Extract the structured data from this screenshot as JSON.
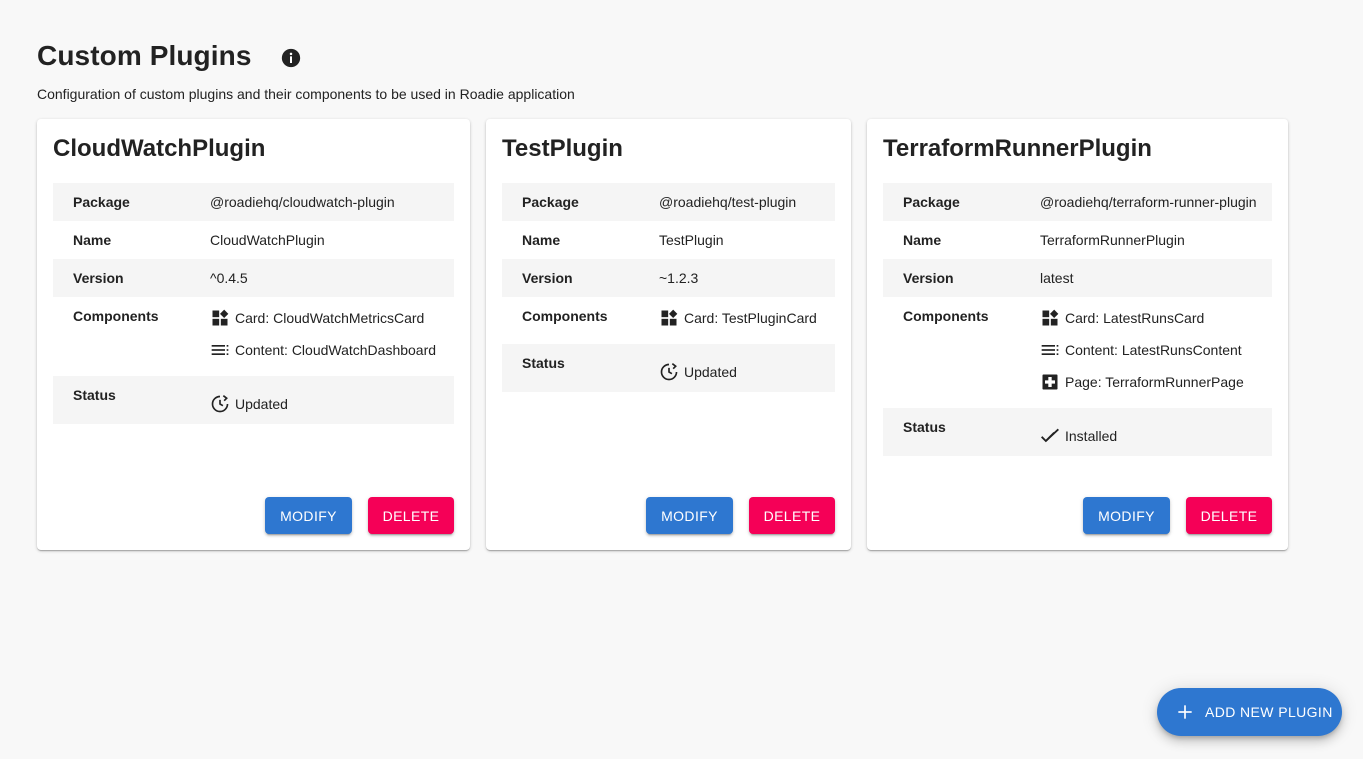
{
  "header": {
    "title": "Custom Plugins",
    "subtitle": "Configuration of custom plugins and their components to be used in Roadie application"
  },
  "labels": {
    "package": "Package",
    "name": "Name",
    "version": "Version",
    "components": "Components",
    "status": "Status",
    "modify": "MODIFY",
    "delete": "DELETE"
  },
  "plugins": [
    {
      "title": "CloudWatchPlugin",
      "package": "@roadiehq/cloudwatch-plugin",
      "name": "CloudWatchPlugin",
      "version": "^0.4.5",
      "components": [
        {
          "icon": "card-icon",
          "text": "Card: CloudWatchMetricsCard"
        },
        {
          "icon": "content-icon",
          "text": "Content: CloudWatchDashboard"
        }
      ],
      "status": {
        "icon": "updated-icon",
        "text": "Updated"
      }
    },
    {
      "title": "TestPlugin",
      "package": "@roadiehq/test-plugin",
      "name": "TestPlugin",
      "version": "~1.2.3",
      "components": [
        {
          "icon": "card-icon",
          "text": "Card: TestPluginCard"
        }
      ],
      "status": {
        "icon": "updated-icon",
        "text": "Updated"
      }
    },
    {
      "title": "TerraformRunnerPlugin",
      "package": "@roadiehq/terraform-runner-plugin",
      "name": "TerraformRunnerPlugin",
      "version": "latest",
      "components": [
        {
          "icon": "card-icon",
          "text": "Card: LatestRunsCard"
        },
        {
          "icon": "content-icon",
          "text": "Content: LatestRunsContent"
        },
        {
          "icon": "page-icon",
          "text": "Page: TerraformRunnerPage"
        }
      ],
      "status": {
        "icon": "installed-icon",
        "text": "Installed"
      }
    }
  ],
  "fab": {
    "label": "ADD NEW PLUGIN",
    "icon": "plus-icon"
  },
  "colors": {
    "primary": "#2e77d0",
    "danger": "#f50057",
    "background": "#f8f8f8",
    "row_shade": "#f5f5f5"
  }
}
